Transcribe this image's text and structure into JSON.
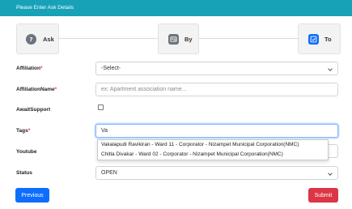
{
  "header": {
    "title": "Please Enter Ask Details"
  },
  "steps": [
    {
      "label": "Ask",
      "icon": "question-circle-icon"
    },
    {
      "label": "By",
      "icon": "id-card-icon"
    },
    {
      "label": "To",
      "icon": "checkbox-icon"
    }
  ],
  "form": {
    "affiliation": {
      "label": "Affiliation",
      "required_mark": "*",
      "value": "-Select-"
    },
    "affiliation_name": {
      "label": "AffiliationName",
      "required_mark": "*",
      "placeholder": "ex: Apartment association name..."
    },
    "await_support": {
      "label": "AwaitSupport",
      "checked": false
    },
    "tags": {
      "label": "Tags",
      "required_mark": "*",
      "value": "Va"
    },
    "youtube": {
      "label": "Youtube"
    },
    "status": {
      "label": "Status",
      "value": "OPEN"
    }
  },
  "suggestions": [
    "Vakalapudi Ravikiran - Ward 11 - Corporator - Nizampet Municipal Corporation(NMC)",
    "Chitla Divakar - Ward 02 - Corporator - Nizampet Municipal Corporation(NMC)"
  ],
  "buttons": {
    "previous": "Previous",
    "submit": "Submit"
  },
  "colors": {
    "header": "#17a2b8",
    "primary": "#0d6efd",
    "danger": "#dc3545",
    "required": "#dc3545"
  }
}
